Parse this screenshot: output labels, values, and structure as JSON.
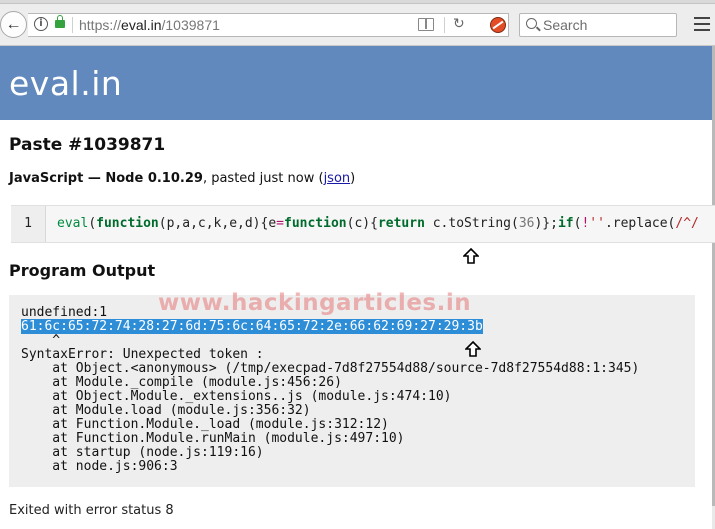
{
  "browser": {
    "url_prefix": "https://",
    "url_domain": "eval.in",
    "url_path": "/1039871",
    "search_placeholder": "Search"
  },
  "site": {
    "logo": "eval.in"
  },
  "paste": {
    "title": "Paste #1039871",
    "lang_label": "JavaScript — Node 0.10.29",
    "pasted_text": ", pasted just now (",
    "json_link": "json",
    "close_paren": ")"
  },
  "code": {
    "line_number": "1",
    "segments": [
      {
        "t": "eval",
        "c": "fn"
      },
      {
        "t": "(",
        "c": ""
      },
      {
        "t": "function",
        "c": "kw"
      },
      {
        "t": "(p,a,c,k,e,d){e",
        "c": ""
      },
      {
        "t": "=",
        "c": "op"
      },
      {
        "t": "function",
        "c": "kw"
      },
      {
        "t": "(c){",
        "c": ""
      },
      {
        "t": "return",
        "c": "kw"
      },
      {
        "t": " c.toString(",
        "c": ""
      },
      {
        "t": "36",
        "c": "num"
      },
      {
        "t": ")};",
        "c": ""
      },
      {
        "t": "if",
        "c": "kw"
      },
      {
        "t": "(",
        "c": ""
      },
      {
        "t": "!",
        "c": "op"
      },
      {
        "t": "''",
        "c": "str"
      },
      {
        "t": ".replace(",
        "c": ""
      },
      {
        "t": "/^/",
        "c": "str"
      }
    ]
  },
  "output": {
    "title": "Program Output",
    "line1": "undefined:1",
    "highlighted": "61:6c:65:72:74:28:27:6d:75:6c:64:65:72:2e:66:62:69:27:29:3b",
    "caret": "    ^",
    "rest": "\nSyntaxError: Unexpected token :\n    at Object.<anonymous> (/tmp/execpad-7d8f27554d88/source-7d8f27554d88:1:345)\n    at Module._compile (module.js:456:26)\n    at Object.Module._extensions..js (module.js:474:10)\n    at Module.load (module.js:356:32)\n    at Function.Module._load (module.js:312:12)\n    at Function.Module.runMain (module.js:497:10)\n    at startup (node.js:119:16)\n    at node.js:906:3",
    "exit_status": "Exited with error status 8"
  },
  "watermark": "www.hackingarticles.in",
  "colors": {
    "header_bg": "#6189bd",
    "highlight": "#2d8dd7",
    "keyword": "#006b2c"
  },
  "icons": [
    "back-arrow-icon",
    "info-icon",
    "lock-icon",
    "reader-view-icon",
    "reload-icon",
    "addon-icon",
    "search-icon",
    "menu-icon",
    "up-arrow-icon"
  ]
}
